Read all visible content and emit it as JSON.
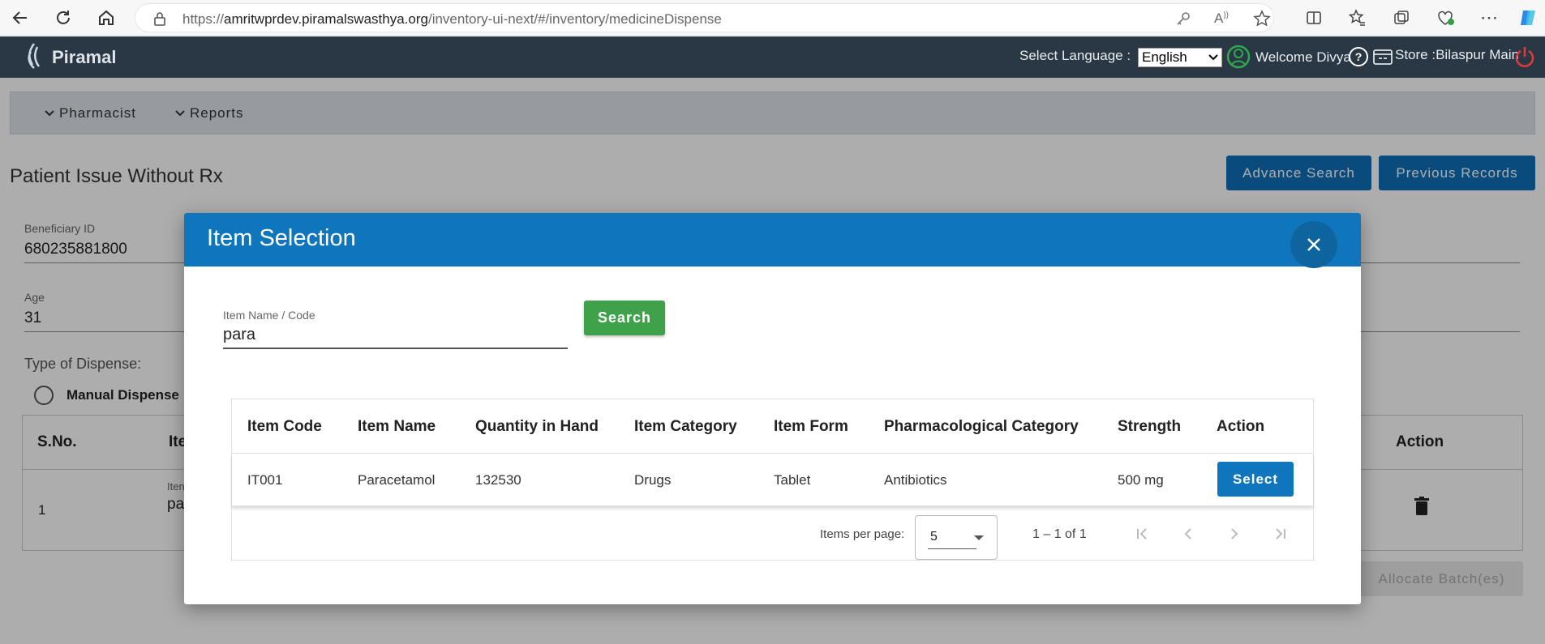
{
  "browser": {
    "url_prefix": "https://",
    "url_host": "amritwprdev.piramalswasthya.org",
    "url_path": "/inventory-ui-next/#/inventory/medicineDispense"
  },
  "header": {
    "logo_text": "Piramal",
    "select_language_label": "Select Language :",
    "language_value": "English",
    "welcome_text": "Welcome Divya",
    "store_text": "Store :Bilaspur Main"
  },
  "menu": {
    "items": [
      {
        "label": "Pharmacist"
      },
      {
        "label": "Reports"
      }
    ]
  },
  "page": {
    "title": "Patient Issue Without Rx",
    "advance_search_label": "Advance Search",
    "previous_records_label": "Previous Records",
    "beneficiary_id_label": "Beneficiary ID",
    "beneficiary_id_value": "680235881800",
    "age_label": "Age",
    "age_value": "31",
    "type_of_dispense_label": "Type of Dispense:",
    "manual_dispense_label": "Manual Dispense",
    "table": {
      "col_sno": "S.No.",
      "col_item": "Ite",
      "col_action": "Action",
      "row_sno": "1",
      "row_item_label": "Iten",
      "row_item_value": "pa"
    },
    "allocate_label": "Allocate Batch(es)"
  },
  "modal": {
    "title": "Item Selection",
    "field_label": "Item Name / Code",
    "field_value": "para",
    "search_label": "Search",
    "columns": [
      "Item Code",
      "Item Name",
      "Quantity in Hand",
      "Item Category",
      "Item Form",
      "Pharmacological Category",
      "Strength",
      "Action"
    ],
    "rows": [
      {
        "item_code": "IT001",
        "item_name": "Paracetamol",
        "quantity": "132530",
        "category": "Drugs",
        "form": "Tablet",
        "pharma_category": "Antibiotics",
        "strength": "500 mg",
        "action_label": "Select"
      }
    ],
    "paginator": {
      "items_per_page_label": "Items per page:",
      "page_size": "5",
      "range_label": "1 – 1 of 1"
    }
  },
  "colors": {
    "header_bg": "#2a3845",
    "primary_blue": "#0f76be",
    "search_green": "#3fa14a"
  }
}
